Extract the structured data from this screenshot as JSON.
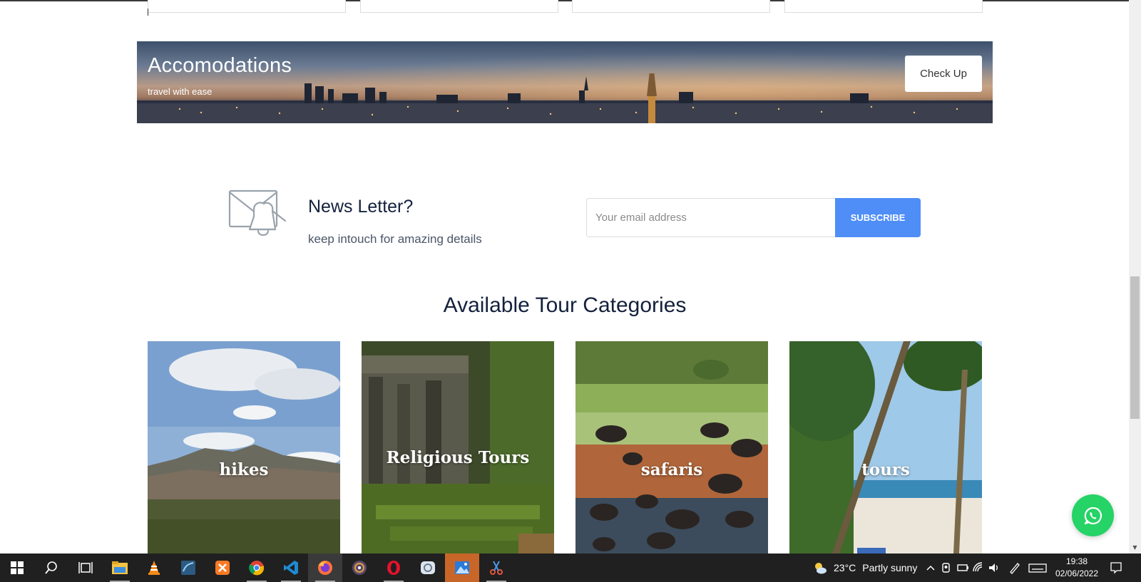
{
  "banner": {
    "title": "Accomodations",
    "subtitle": "travel with ease",
    "button_label": "Check Up"
  },
  "newsletter": {
    "title": "News Letter?",
    "subtitle": "keep intouch for amazing details",
    "email_placeholder": "Your email address",
    "button_label": "SUBSCRIBE"
  },
  "categories": {
    "heading": "Available Tour Categories",
    "items": [
      {
        "label": "hikes"
      },
      {
        "label": "Religious Tours"
      },
      {
        "label": "safaris"
      },
      {
        "label": "tours"
      }
    ]
  },
  "taskbar": {
    "apps": [
      "windows-start-icon",
      "search-icon",
      "task-view-icon",
      "file-explorer-icon",
      "vlc-icon",
      "mysql-workbench-icon",
      "xampp-icon",
      "chrome-icon",
      "vscode-icon",
      "firefox-icon",
      "media-player-icon",
      "opera-icon",
      "settings-app-icon",
      "photos-icon",
      "snip-tool-icon"
    ],
    "weather_temp": "23°C",
    "weather_desc": "Partly sunny",
    "time": "19:38",
    "date": "02/06/2022"
  },
  "colors": {
    "accent_blue": "#4f8ef7",
    "heading_navy": "#14213d",
    "whatsapp_green": "#25d366"
  }
}
